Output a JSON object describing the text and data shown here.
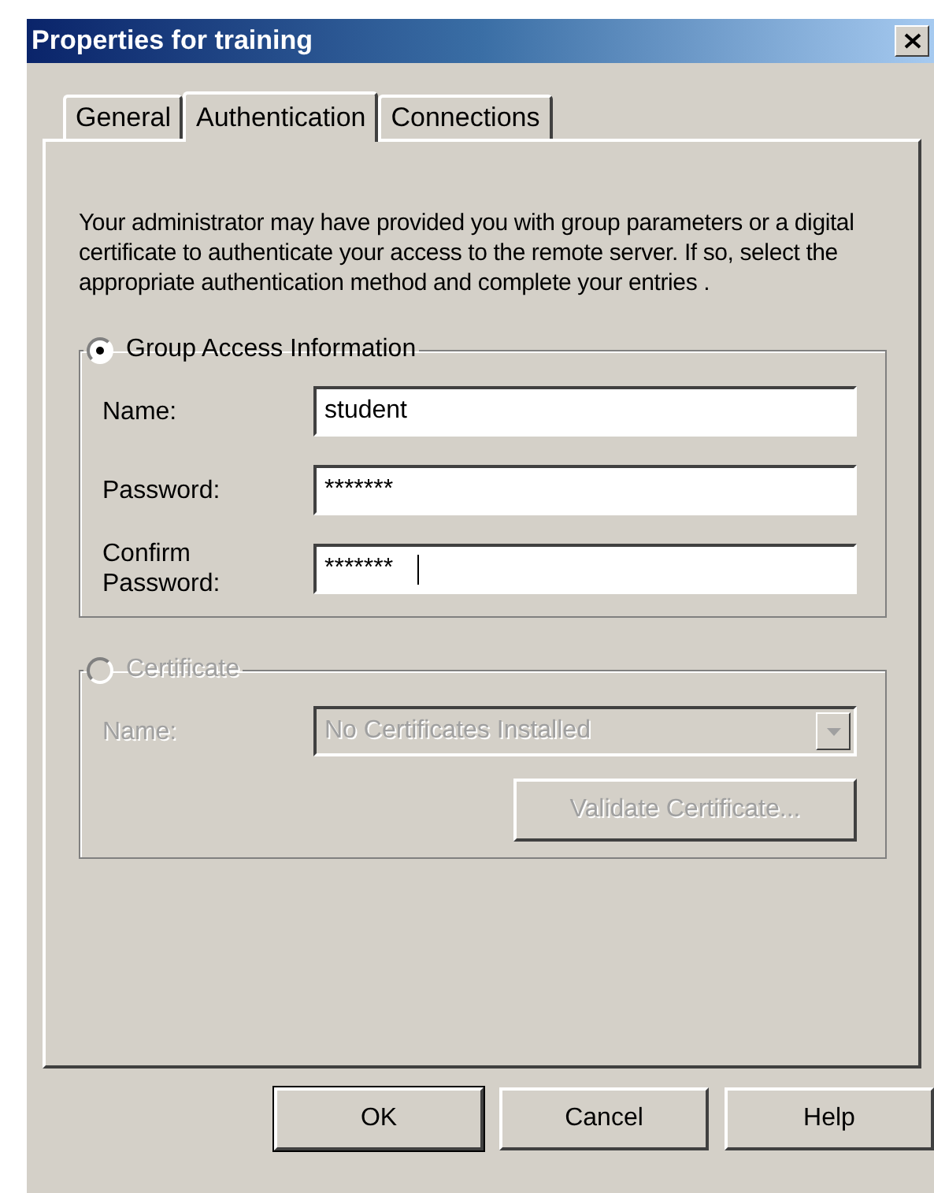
{
  "window": {
    "title": "Properties for training"
  },
  "tabs": [
    {
      "label": "General",
      "selected": false
    },
    {
      "label": "Authentication",
      "selected": true
    },
    {
      "label": "Connections",
      "selected": false
    }
  ],
  "description": "Your administrator may have provided you with group parameters or a digital certificate to authenticate your   access to the remote server.  If so, select the appropriate authentication method and complete your entries .",
  "groups": [
    {
      "label": "Group Access Information",
      "selected": true,
      "disabled": false,
      "fields": [
        {
          "kind": "text",
          "label": "Name:",
          "value": "student"
        },
        {
          "kind": "text",
          "label": "Password:",
          "value": "*******"
        },
        {
          "kind": "text",
          "label": "Confirm Password:",
          "value": "*******",
          "focused": true
        }
      ]
    },
    {
      "label": "Certificate",
      "selected": false,
      "disabled": true,
      "fields": [
        {
          "kind": "dropdown",
          "label": "Name:",
          "value": "No Certificates Installed"
        }
      ],
      "button": "Validate Certificate..."
    }
  ],
  "buttons": [
    {
      "label": "OK",
      "default": true
    },
    {
      "label": "Cancel",
      "default": false
    },
    {
      "label": "Help",
      "default": false
    }
  ]
}
